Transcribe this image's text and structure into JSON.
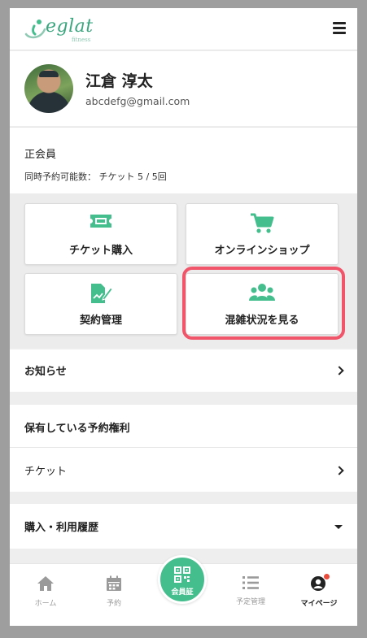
{
  "brand": {
    "logo_text": "eglat",
    "logo_sub": "fitness",
    "accent": "#45be8e"
  },
  "profile": {
    "name": "江倉 淳太",
    "email": "abcdefg@gmail.com"
  },
  "membership": {
    "type": "正会員",
    "reservation_count": "同時予約可能数： チケット 5 / 5回"
  },
  "menu": {
    "ticket_purchase": "チケット購入",
    "online_shop": "オンラインショップ",
    "contract": "契約管理",
    "congestion": "混雑状況を見る"
  },
  "news": {
    "label": "お知らせ"
  },
  "rights": {
    "heading": "保有している予約権利",
    "ticket": "チケット"
  },
  "history": {
    "label": "購入・利用履歴"
  },
  "nav": {
    "home": "ホーム",
    "reserve": "予約",
    "member_card": "会員証",
    "schedule": "予定管理",
    "mypage": "マイページ"
  },
  "highlight_color": "#f0556a"
}
